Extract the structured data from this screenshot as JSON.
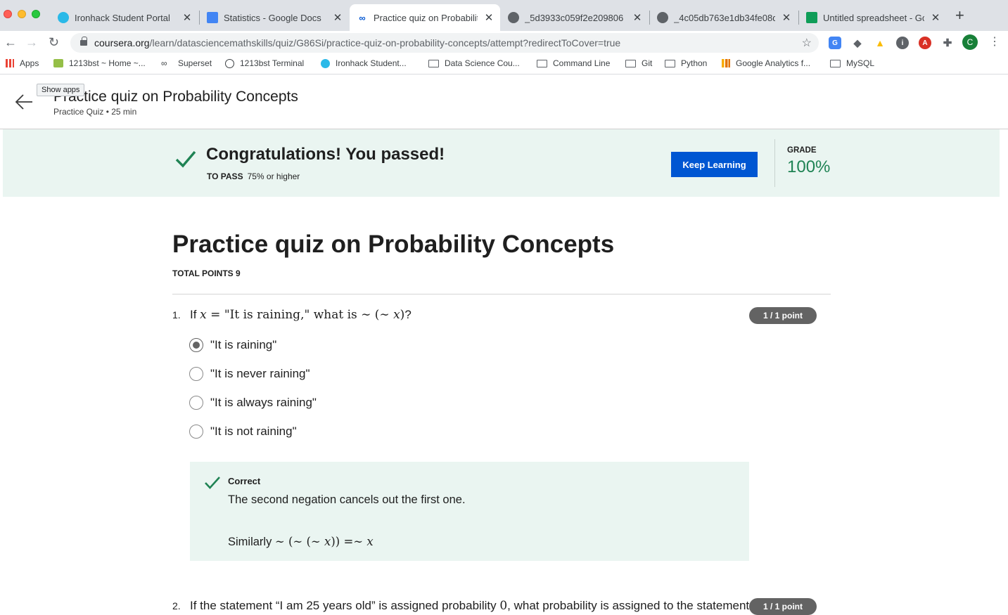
{
  "browser": {
    "tabs": [
      {
        "title": "Ironhack Student Portal",
        "favicon": "ironhack-icon",
        "color": "#2ab9e8"
      },
      {
        "title": "Statistics - Google Docs",
        "favicon": "google-docs-icon",
        "color": "#4285f4"
      },
      {
        "title": "Practice quiz on Probabilit",
        "favicon": "coursera-icon",
        "color": "#0056d2"
      },
      {
        "title": "_5d3933c059f2e209806",
        "favicon": "globe-icon",
        "color": "#5f6368"
      },
      {
        "title": "_4c05db763e1db34fe08d",
        "favicon": "globe-icon",
        "color": "#5f6368"
      },
      {
        "title": "Untitled spreadsheet - Go",
        "favicon": "google-sheets-icon",
        "color": "#0f9d58"
      }
    ],
    "url_host": "coursera.org",
    "url_path": "/learn/datasciencemathskills/quiz/G86Si/practice-quiz-on-probability-concepts/attempt?redirectToCover=true",
    "profile_initial": "C",
    "bookmarks": [
      {
        "label": "Apps",
        "icon": "apps-grid-icon"
      },
      {
        "label": "1213bst ~ Home ~...",
        "icon": "shopify-icon"
      },
      {
        "label": "Superset",
        "icon": "superset-icon"
      },
      {
        "label": "1213bst Terminal",
        "icon": "globe-icon"
      },
      {
        "label": "Ironhack Student...",
        "icon": "ironhack-icon"
      },
      {
        "label": "Data Science Cou...",
        "icon": "folder-icon"
      },
      {
        "label": "Command Line",
        "icon": "folder-icon"
      },
      {
        "label": "Git",
        "icon": "folder-icon"
      },
      {
        "label": "Python",
        "icon": "folder-icon"
      },
      {
        "label": "Google Analytics f...",
        "icon": "analytics-icon"
      },
      {
        "label": "MySQL",
        "icon": "folder-icon"
      }
    ],
    "tooltip": "Show apps"
  },
  "header": {
    "title": "Practice quiz on Probability Concepts",
    "subtitle": "Practice Quiz • 25 min"
  },
  "banner": {
    "message": "Congratulations! You passed!",
    "to_pass_label": "TO PASS",
    "to_pass_value": "75% or higher",
    "button": "Keep Learning",
    "grade_label": "GRADE",
    "grade_value": "100%"
  },
  "quiz": {
    "title": "Practice quiz on Probability Concepts",
    "total_points": "TOTAL POINTS 9",
    "q1": {
      "number": "1.",
      "prefix": "If ",
      "var": "x",
      "mid": " = \"It is raining,\" what is ",
      "expr_open": "∼ (∼ ",
      "expr_close": ")",
      "suffix": "?",
      "points": "1 / 1 point",
      "options": [
        {
          "label": "\"It is raining\"",
          "checked": true
        },
        {
          "label": "\"It is never raining\"",
          "checked": false
        },
        {
          "label": "\"It is always raining\"",
          "checked": false
        },
        {
          "label": "\"It is not raining\"",
          "checked": false
        }
      ],
      "feedback_label": "Correct",
      "feedback_text": "The second negation cancels out the first one.",
      "feedback_similarly": "Similarly ",
      "feedback_expr_a": "∼ (∼ (∼ ",
      "feedback_expr_b": ")) =∼ "
    },
    "q2": {
      "number": "2.",
      "prefix": "If the statement “I am 25 years old” is assigned probability ",
      "zero": "0",
      "suffix": ", what probability is assigned to the statement",
      "points": "1 / 1 point"
    }
  },
  "colors": {
    "accent": "#0056d2",
    "success": "#1f8354",
    "banner_bg": "#eaf5f1",
    "badge_bg": "#636363"
  }
}
